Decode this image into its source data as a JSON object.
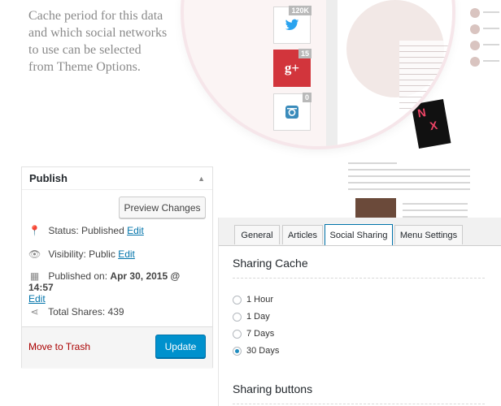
{
  "intro": {
    "line1": "Cache period for this data",
    "line2": "and which social networks",
    "line3": "to use can be selected",
    "line4": "from Theme Options."
  },
  "social_buttons": [
    {
      "icon": "twitter-icon",
      "count": "120K"
    },
    {
      "icon": "google-plus-icon",
      "label": "g+",
      "count": "15"
    },
    {
      "icon": "linkedin-icon",
      "count": "0"
    }
  ],
  "publish": {
    "title": "Publish",
    "preview_label": "Preview Changes",
    "status_label": "Status:",
    "status_value": "Published",
    "visibility_label": "Visibility:",
    "visibility_value": "Public",
    "published_label": "Published on:",
    "published_value": "Apr 30, 2015 @ 14:57",
    "edit_label": "Edit",
    "shares_label": "Total Shares:",
    "shares_value": "439",
    "trash_label": "Move to Trash",
    "update_label": "Update"
  },
  "settings": {
    "tabs": [
      "General",
      "Articles",
      "Social Sharing",
      "Menu Settings"
    ],
    "active_tab": "Social Sharing",
    "cache_title": "Sharing Cache",
    "cache_options": [
      "1 Hour",
      "1 Day",
      "7 Days",
      "30 Days"
    ],
    "cache_selected": "30 Days",
    "buttons_title": "Sharing buttons"
  },
  "colors": {
    "accent": "#0073aa",
    "update": "#0091cd",
    "trash": "#aa0000",
    "google": "#d2353c",
    "twitter": "#2aa3ef"
  }
}
